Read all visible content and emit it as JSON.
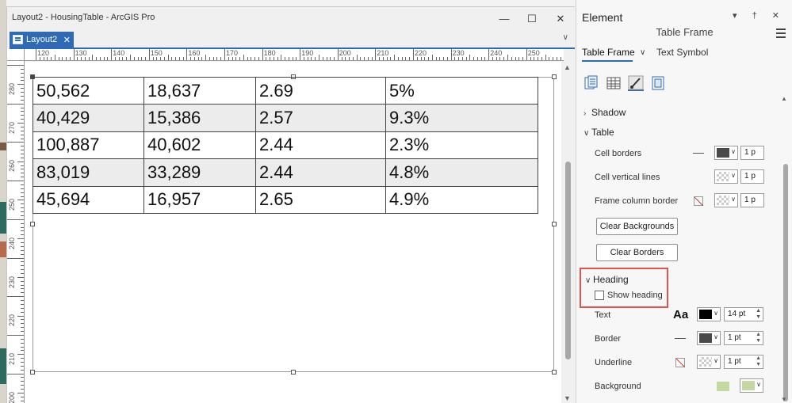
{
  "window": {
    "title": "Layout2 - HousingTable - ArcGIS Pro",
    "controls": [
      "—",
      "☐",
      "✕"
    ]
  },
  "tab": {
    "label": "Layout2",
    "close": "✕",
    "overflow": "∨"
  },
  "ruler": {
    "h_labels": [
      "120",
      "130",
      "140",
      "150",
      "160",
      "170",
      "180",
      "190",
      "200",
      "210",
      "220",
      "230",
      "240",
      "250"
    ],
    "v_labels": [
      "280",
      "270",
      "260",
      "250",
      "240",
      "230",
      "220",
      "210",
      "200"
    ]
  },
  "table": {
    "rows": [
      [
        "50,562",
        "18,637",
        "2.69",
        "5%"
      ],
      [
        "40,429",
        "15,386",
        "2.57",
        "9.3%"
      ],
      [
        "100,887",
        "40,602",
        "2.44",
        "2.3%"
      ],
      [
        "83,019",
        "33,289",
        "2.44",
        "4.8%"
      ],
      [
        "45,694",
        "16,957",
        "2.65",
        "4.9%"
      ]
    ],
    "alt_row_color": "#ececec"
  },
  "pane": {
    "title": "Element",
    "controls": "▾ † ✕",
    "subtitle": "Table Frame",
    "tab_active": "Table Frame",
    "tab_other": "Text Symbol",
    "icons": [
      "options-icon",
      "table-icon",
      "brush-icon",
      "frame-icon"
    ],
    "sections": {
      "shadow": "Shadow",
      "table": "Table",
      "heading": "Heading"
    },
    "rows": {
      "cell_borders": {
        "label": "Cell borders",
        "value": "1 p",
        "color": "#4a4a4a"
      },
      "cell_vertical": {
        "label": "Cell vertical lines",
        "value": "1 p"
      },
      "frame_column": {
        "label": "Frame column border",
        "value": "1 p"
      },
      "text": {
        "label": "Text",
        "value": "14 pt",
        "color": "#000000",
        "glyph": "Aa"
      },
      "border": {
        "label": "Border",
        "value": "1 pt",
        "color": "#4a4a4a"
      },
      "underline": {
        "label": "Underline",
        "value": "1 pt"
      },
      "background": {
        "label": "Background",
        "color": "#c5d8a4"
      }
    },
    "buttons": {
      "clear_backgrounds": "Clear Backgrounds",
      "clear_borders": "Clear Borders"
    },
    "show_heading": {
      "label": "Show heading",
      "checked": false
    },
    "highlight_color": "#e0554f",
    "accent": "#2f6ab5"
  }
}
